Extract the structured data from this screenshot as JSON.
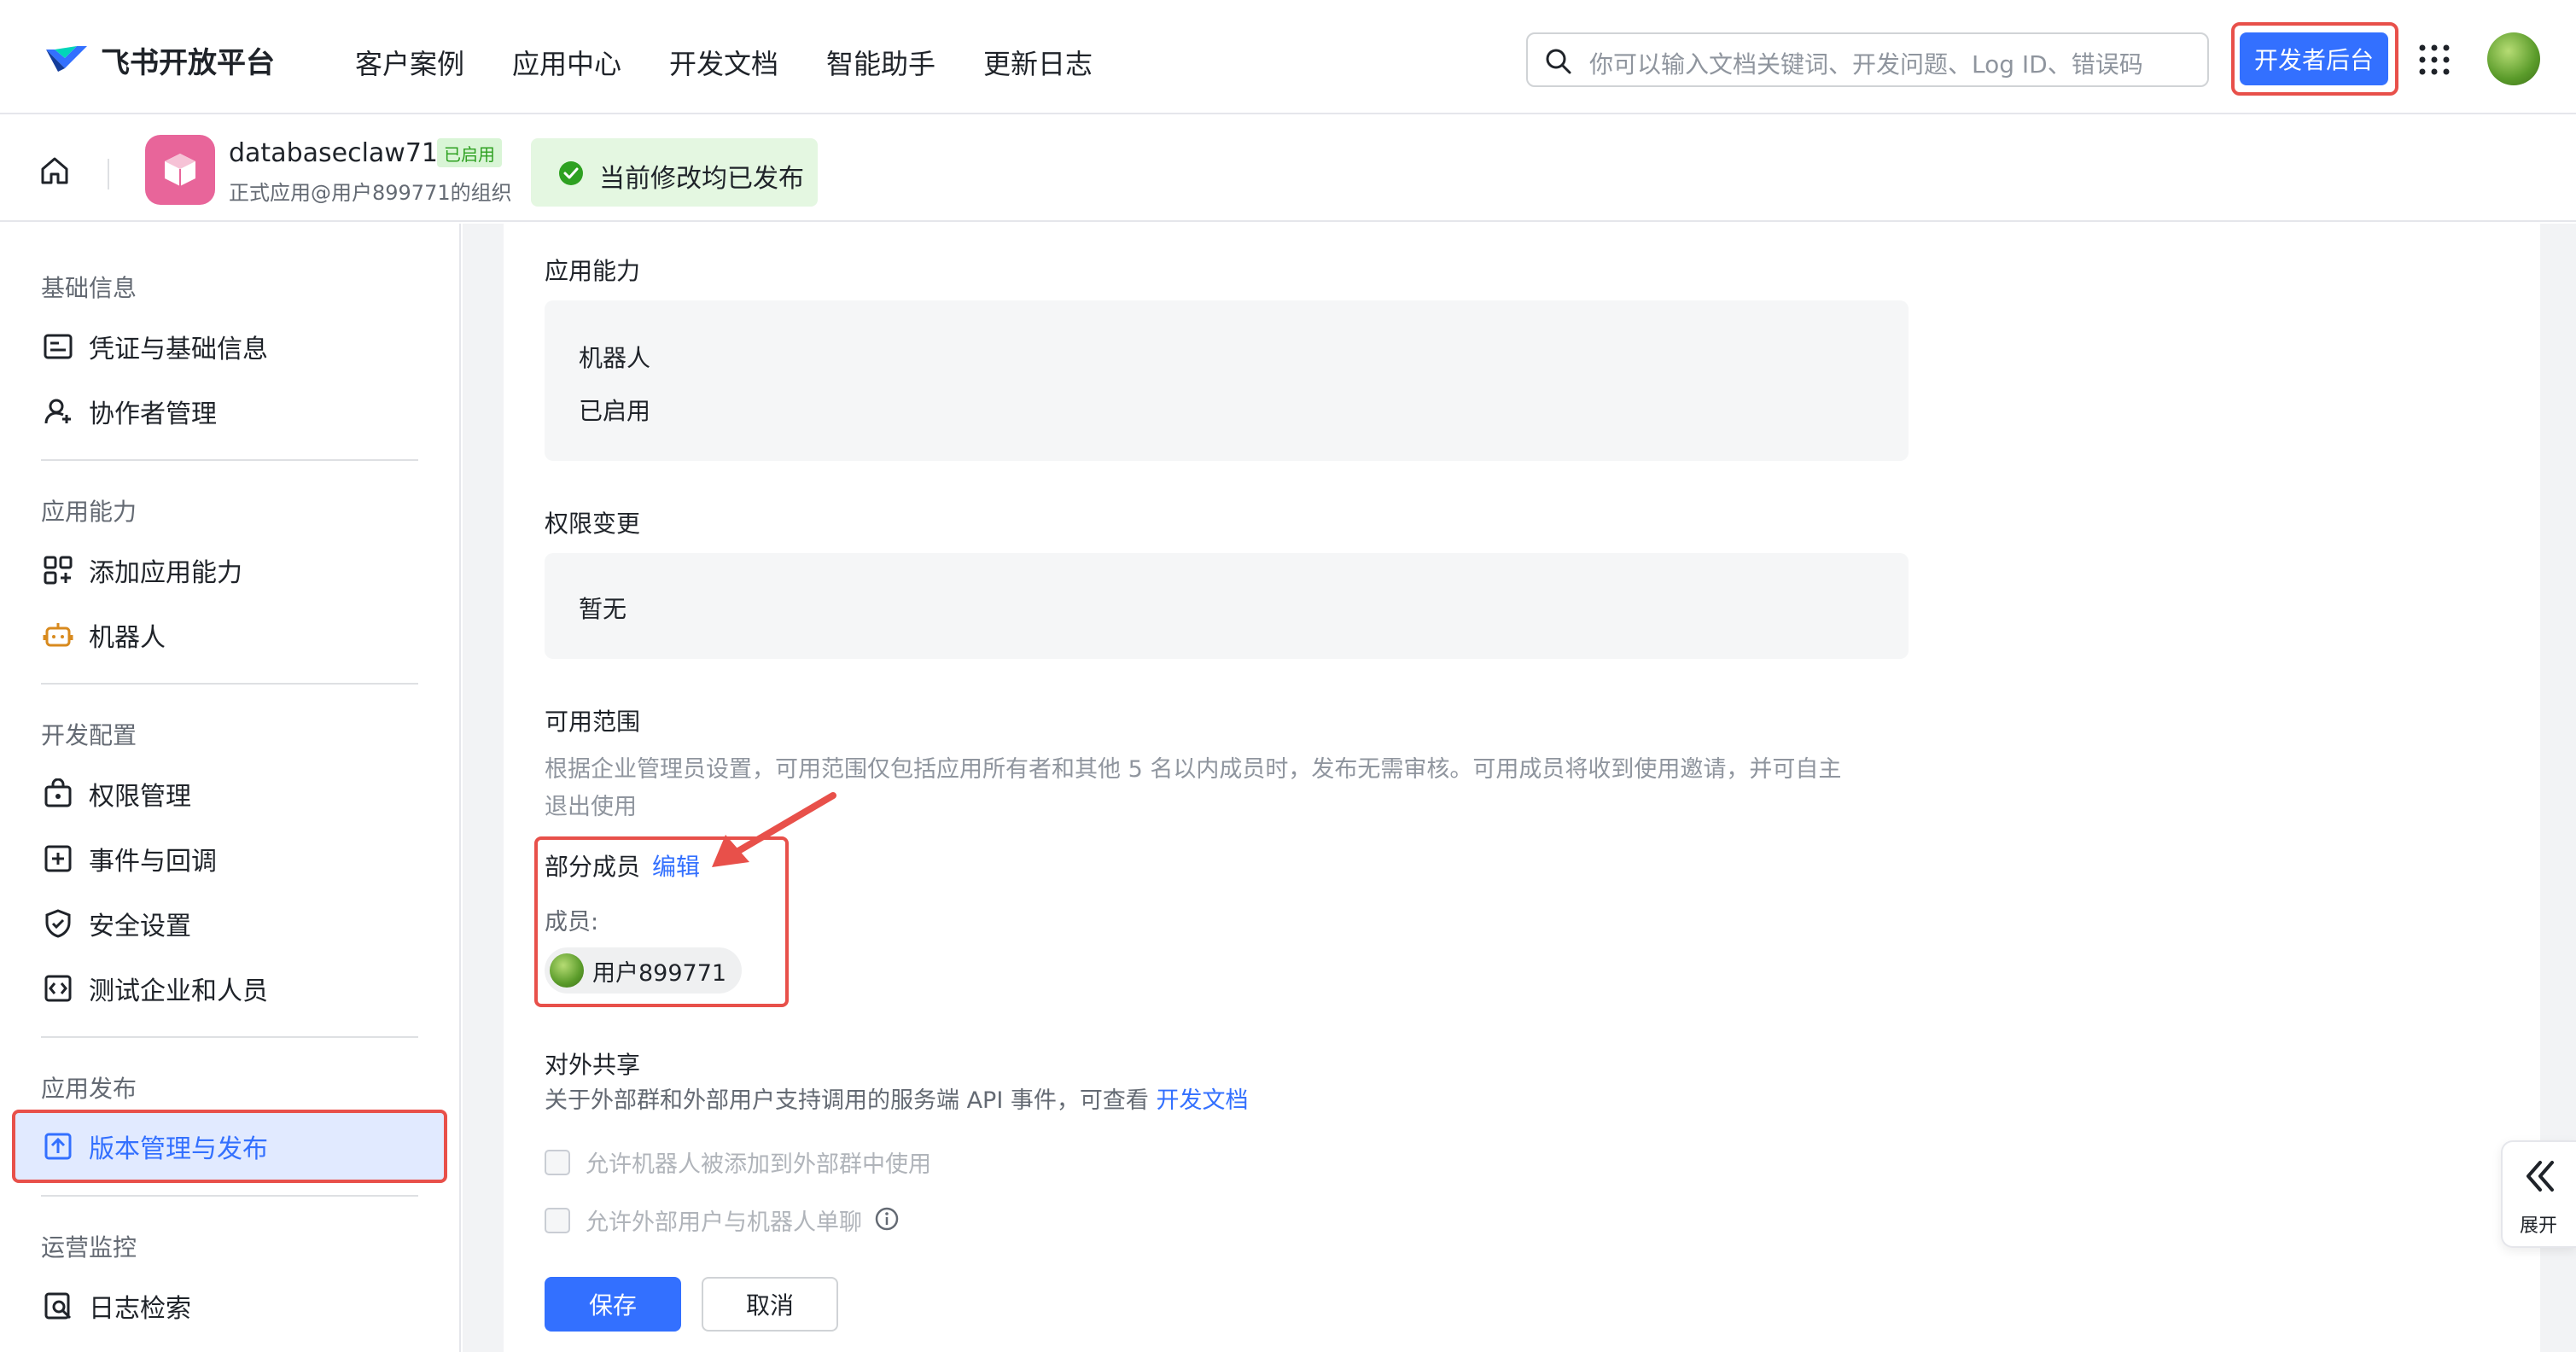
{
  "topnav": {
    "brand": "飞书开放平台",
    "links": [
      "客户案例",
      "应用中心",
      "开发文档",
      "智能助手",
      "更新日志"
    ],
    "search_placeholder": "你可以输入文档关键词、开发问题、Log ID、错误码",
    "dev_console_label": "开发者后台"
  },
  "app": {
    "name": "databaseclaw713",
    "badge": "已启用",
    "org": "正式应用@用户899771的组织",
    "publish_status": "当前修改均已发布"
  },
  "sidebar": {
    "sections": [
      {
        "title": "基础信息",
        "items": [
          {
            "label": "凭证与基础信息",
            "icon": "credential-icon"
          },
          {
            "label": "协作者管理",
            "icon": "collaborator-icon"
          }
        ]
      },
      {
        "title": "应用能力",
        "items": [
          {
            "label": "添加应用能力",
            "icon": "add-capability-icon"
          },
          {
            "label": "机器人",
            "icon": "robot-icon"
          }
        ]
      },
      {
        "title": "开发配置",
        "items": [
          {
            "label": "权限管理",
            "icon": "permission-icon"
          },
          {
            "label": "事件与回调",
            "icon": "event-icon"
          },
          {
            "label": "安全设置",
            "icon": "shield-icon"
          },
          {
            "label": "测试企业和人员",
            "icon": "test-icon"
          }
        ]
      },
      {
        "title": "应用发布",
        "items": [
          {
            "label": "版本管理与发布",
            "icon": "upload-icon",
            "active": true
          }
        ]
      },
      {
        "title": "运营监控",
        "items": [
          {
            "label": "日志检索",
            "icon": "log-search-icon"
          }
        ]
      }
    ]
  },
  "main": {
    "capability": {
      "title": "应用能力",
      "line1": "机器人",
      "line2": "已启用"
    },
    "permission_change": {
      "title": "权限变更",
      "value": "暂无"
    },
    "scope": {
      "title": "可用范围",
      "desc_line1": "根据企业管理员设置，可用范围仅包括应用所有者和其他 5 名以内成员时，发布无需审核。可用成员将收到使用邀请，并可自主",
      "desc_line2": "退出使用",
      "partial_label": "部分成员",
      "edit_label": "编辑",
      "members_label": "成员:",
      "member_name": "用户899771"
    },
    "external_share": {
      "title": "对外共享",
      "desc": "关于外部群和外部用户支持调用的服务端 API 事件，可查看",
      "doc_link": "开发文档",
      "option1": "允许机器人被添加到外部群中使用",
      "option2": "允许外部用户与机器人单聊"
    },
    "save_label": "保存",
    "cancel_label": "取消"
  },
  "expand": {
    "label": "展开"
  },
  "colors": {
    "primary": "#3370ff",
    "highlight": "#e8504a",
    "success_bg": "#e4f7e1",
    "success": "#2ea121"
  }
}
